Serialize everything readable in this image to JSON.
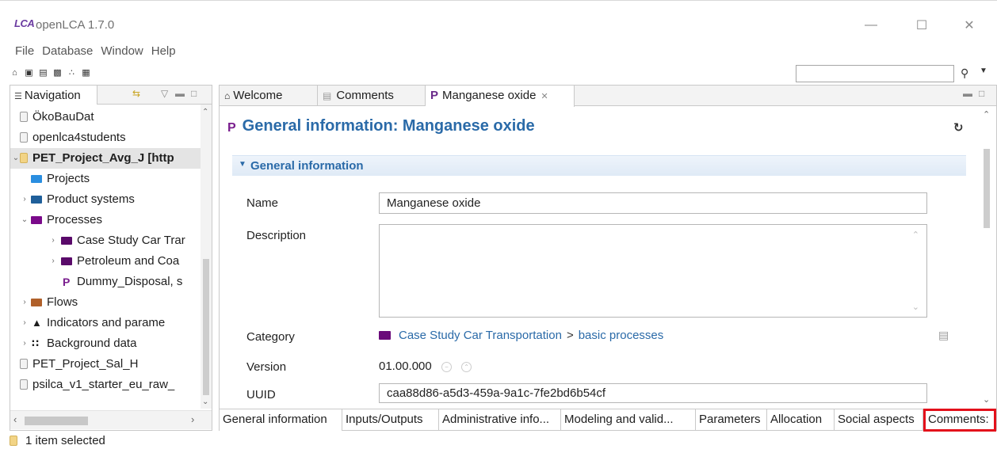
{
  "app": {
    "logo": "LCA",
    "title": "openLCA 1.7.0"
  },
  "menu": [
    "File",
    "Database",
    "Window",
    "Help"
  ],
  "navigation": {
    "tab_label": "Navigation",
    "tree": [
      {
        "label": "ÖkoBauDat",
        "type": "database"
      },
      {
        "label": "openlca4students",
        "type": "database"
      },
      {
        "label": "PET_Project_Avg_J [http",
        "type": "database-active",
        "expanded": true
      },
      {
        "label": "Projects",
        "type": "folder",
        "color": "#2a8ee0"
      },
      {
        "label": "Product systems",
        "type": "folder",
        "color": "#1f5f9a"
      },
      {
        "label": "Processes",
        "type": "folder",
        "color": "#7a0a8a",
        "expanded": true
      },
      {
        "label": "Case Study Car Trar",
        "type": "folder",
        "color": "#5a0a6a"
      },
      {
        "label": "Petroleum and Coa",
        "type": "folder",
        "color": "#5a0a6a"
      },
      {
        "label": "Dummy_Disposal, s",
        "type": "process"
      },
      {
        "label": "Flows",
        "type": "folder",
        "color": "#b0602a"
      },
      {
        "label": "Indicators and parame",
        "type": "indicators"
      },
      {
        "label": "Background data",
        "type": "background"
      },
      {
        "label": "PET_Project_Sal_H",
        "type": "database"
      },
      {
        "label": "psilca_v1_starter_eu_raw_",
        "type": "database"
      }
    ]
  },
  "editor": {
    "tabs": [
      "Welcome",
      "Comments",
      "Manganese oxide"
    ],
    "heading": "General information: Manganese oxide",
    "section_title": "General information",
    "fields": {
      "name_label": "Name",
      "name_value": "Manganese oxide",
      "description_label": "Description",
      "category_label": "Category",
      "category_path": "Case Study Car Transportation",
      "category_sep": ">",
      "category_leaf": "basic processes",
      "version_label": "Version",
      "version_value": "01.00.000",
      "uuid_label": "UUID",
      "uuid_value": "caa88d86-a5d3-459a-9a1c-7fe2bd6b54cf"
    },
    "page_tabs": [
      "General information",
      "Inputs/Outputs",
      "Administrative info...",
      "Modeling and valid...",
      "Parameters",
      "Allocation",
      "Social aspects",
      "Comments:"
    ],
    "highlighted_tab": "Comments:",
    "highlight_color": "#e3101b"
  },
  "status": {
    "text": "1 item selected"
  }
}
